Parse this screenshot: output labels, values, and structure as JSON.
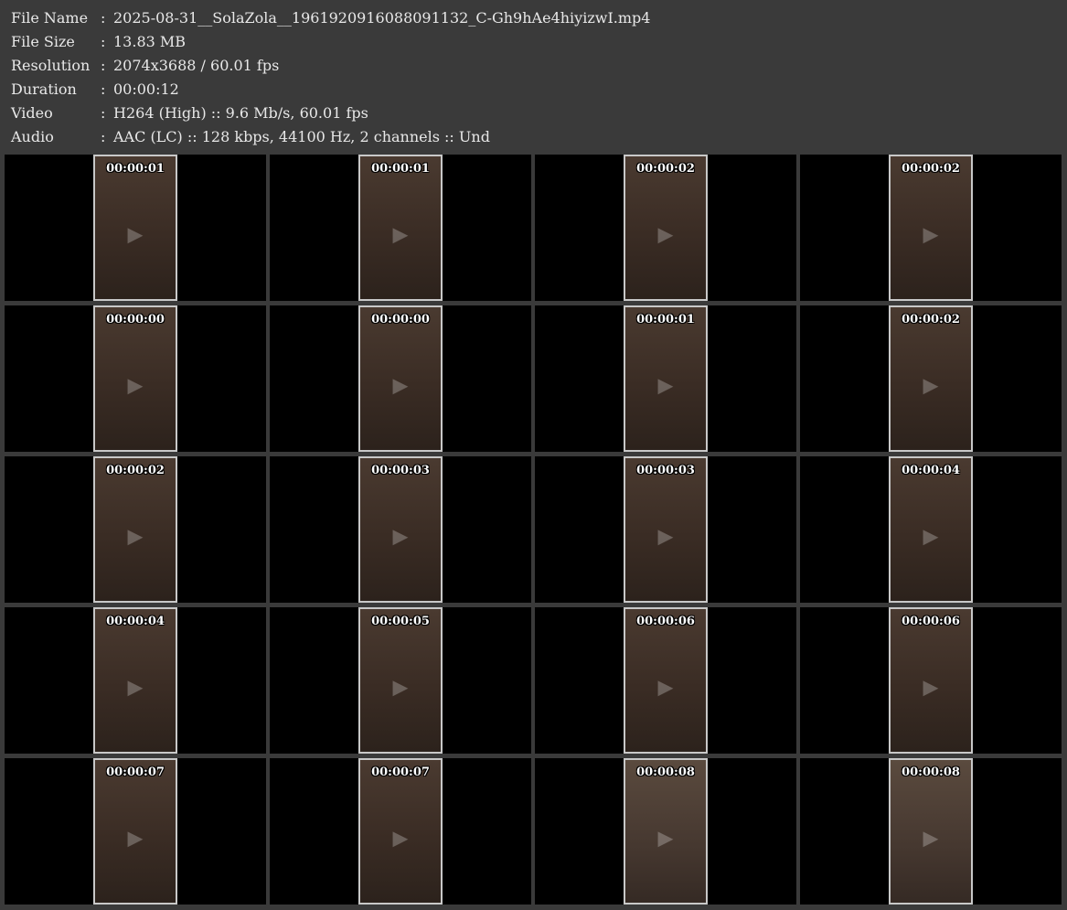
{
  "info": {
    "separator": ":",
    "rows": [
      {
        "label": "File Name",
        "value": "2025-08-31__SolaZola__1961920916088091132_C-Gh9hAe4hiyizwI.mp4"
      },
      {
        "label": "File Size",
        "value": "13.83 MB"
      },
      {
        "label": "Resolution",
        "value": "2074x3688 / 60.01 fps"
      },
      {
        "label": "Duration",
        "value": "00:00:12"
      },
      {
        "label": "Video",
        "value": "H264 (High) :: 9.6 Mb/s, 60.01 fps"
      },
      {
        "label": "Audio",
        "value": "AAC (LC) :: 128 kbps, 44100 Hz, 2 channels :: Und"
      }
    ]
  },
  "thumbnails": [
    {
      "timestamp": "00:00:01",
      "kind": "frame"
    },
    {
      "timestamp": "00:00:01",
      "kind": "frame"
    },
    {
      "timestamp": "00:00:02",
      "kind": "frame"
    },
    {
      "timestamp": "00:00:02",
      "kind": "frame"
    },
    {
      "timestamp": "00:00:00",
      "kind": "frame"
    },
    {
      "timestamp": "00:00:00",
      "kind": "frame"
    },
    {
      "timestamp": "00:00:01",
      "kind": "frame"
    },
    {
      "timestamp": "00:00:02",
      "kind": "frame"
    },
    {
      "timestamp": "00:00:02",
      "kind": "frame"
    },
    {
      "timestamp": "00:00:03",
      "kind": "frame"
    },
    {
      "timestamp": "00:00:03",
      "kind": "frame"
    },
    {
      "timestamp": "00:00:04",
      "kind": "frame"
    },
    {
      "timestamp": "00:00:04",
      "kind": "frame"
    },
    {
      "timestamp": "00:00:05",
      "kind": "frame"
    },
    {
      "timestamp": "00:00:06",
      "kind": "frame"
    },
    {
      "timestamp": "00:00:06",
      "kind": "frame"
    },
    {
      "timestamp": "00:00:07",
      "kind": "frame"
    },
    {
      "timestamp": "00:00:07",
      "kind": "frame"
    },
    {
      "timestamp": "00:00:08",
      "kind": "closeup"
    },
    {
      "timestamp": "00:00:08",
      "kind": "closeup"
    }
  ],
  "placeholder_icon": "video-frame-icon",
  "colors": {
    "background": "#3a3a3a",
    "cell": "#000000",
    "text": "#e8e8e8",
    "frame_border": "#c8c8c8"
  }
}
